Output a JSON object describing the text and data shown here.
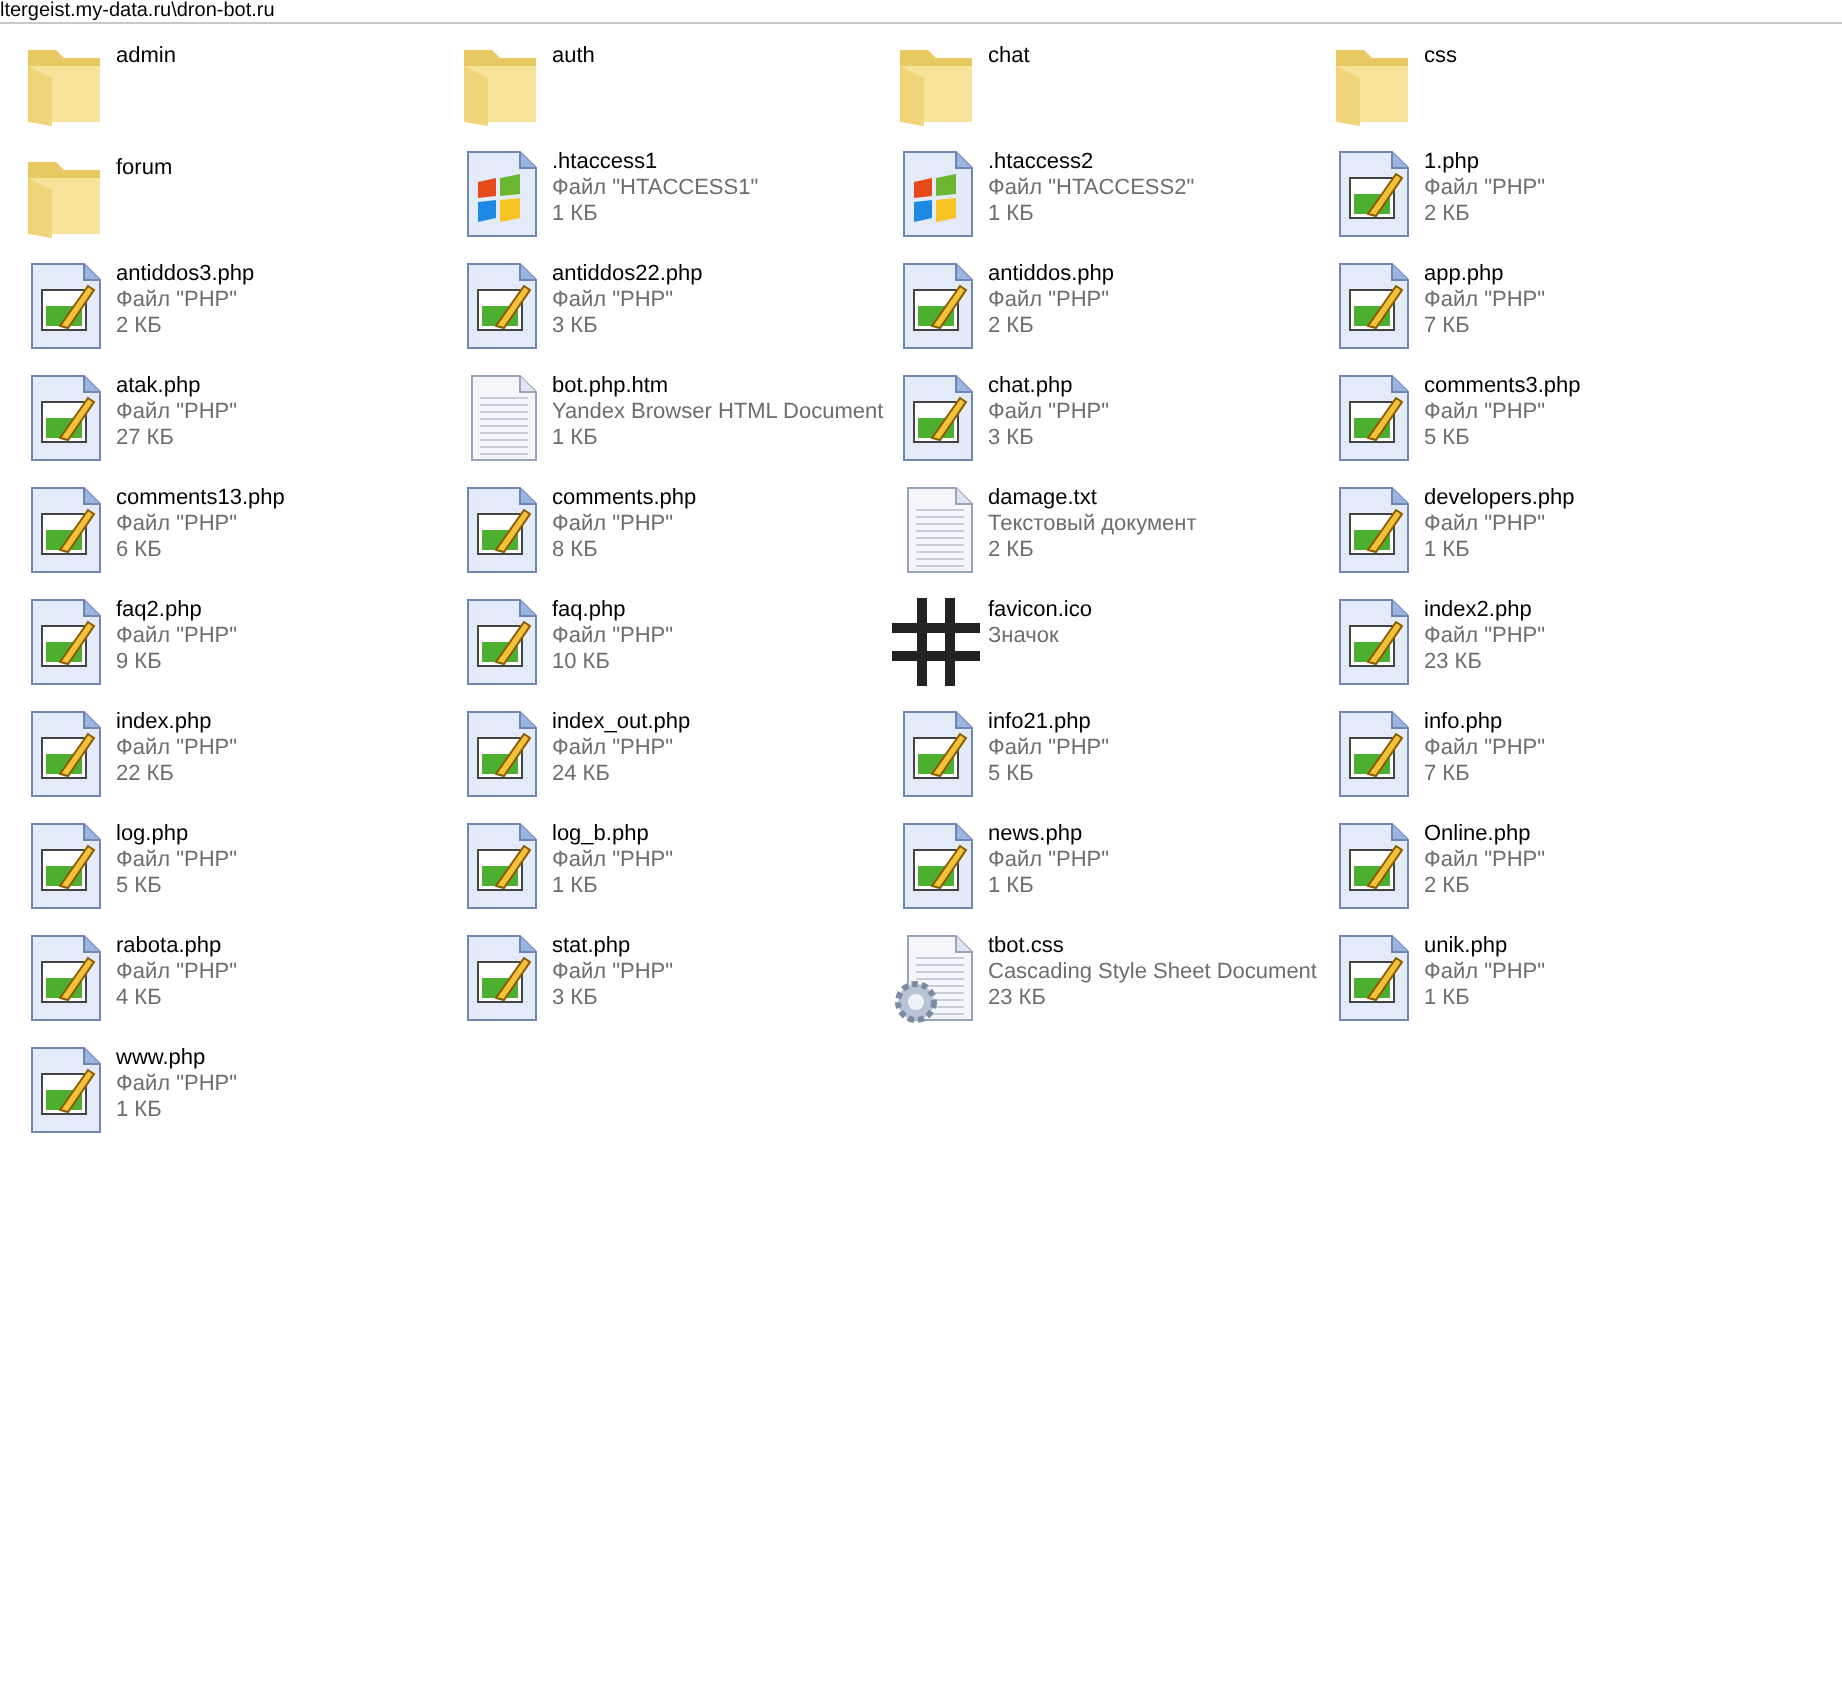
{
  "address_bar": {
    "path": "ltergeist.my-data.ru\\dron-bot.ru"
  },
  "items": [
    {
      "kind": "folder",
      "name": "admin"
    },
    {
      "kind": "folder",
      "name": "auth"
    },
    {
      "kind": "folder",
      "name": "chat"
    },
    {
      "kind": "folder",
      "name": "css"
    },
    {
      "kind": "folder",
      "name": "forum"
    },
    {
      "kind": "windows",
      "name": ".htaccess1",
      "type": "Файл \"HTACCESS1\"",
      "size": "1 КБ"
    },
    {
      "kind": "windows",
      "name": ".htaccess2",
      "type": "Файл \"HTACCESS2\"",
      "size": "1 КБ"
    },
    {
      "kind": "php",
      "name": "1.php",
      "type": "Файл \"PHP\"",
      "size": "2 КБ"
    },
    {
      "kind": "php",
      "name": "antiddos3.php",
      "type": "Файл \"PHP\"",
      "size": "2 КБ"
    },
    {
      "kind": "php",
      "name": "antiddos22.php",
      "type": "Файл \"PHP\"",
      "size": "3 КБ"
    },
    {
      "kind": "php",
      "name": "antiddos.php",
      "type": "Файл \"PHP\"",
      "size": "2 КБ"
    },
    {
      "kind": "php",
      "name": "app.php",
      "type": "Файл \"PHP\"",
      "size": "7 КБ"
    },
    {
      "kind": "php",
      "name": "atak.php",
      "type": "Файл \"PHP\"",
      "size": "27 КБ"
    },
    {
      "kind": "text",
      "name": "bot.php.htm",
      "type": "Yandex Browser HTML Document",
      "size": "1 КБ"
    },
    {
      "kind": "php",
      "name": "chat.php",
      "type": "Файл \"PHP\"",
      "size": "3 КБ"
    },
    {
      "kind": "php",
      "name": "comments3.php",
      "type": "Файл \"PHP\"",
      "size": "5 КБ"
    },
    {
      "kind": "php",
      "name": "comments13.php",
      "type": "Файл \"PHP\"",
      "size": "6 КБ"
    },
    {
      "kind": "php",
      "name": "comments.php",
      "type": "Файл \"PHP\"",
      "size": "8 КБ"
    },
    {
      "kind": "text",
      "name": "damage.txt",
      "type": "Текстовый документ",
      "size": "2 КБ"
    },
    {
      "kind": "php",
      "name": "developers.php",
      "type": "Файл \"PHP\"",
      "size": "1 КБ"
    },
    {
      "kind": "php",
      "name": "faq2.php",
      "type": "Файл \"PHP\"",
      "size": "9 КБ"
    },
    {
      "kind": "php",
      "name": "faq.php",
      "type": "Файл \"PHP\"",
      "size": "10 КБ"
    },
    {
      "kind": "hash",
      "name": "favicon.ico",
      "type": "Значок"
    },
    {
      "kind": "php",
      "name": "index2.php",
      "type": "Файл \"PHP\"",
      "size": "23 КБ"
    },
    {
      "kind": "php",
      "name": "index.php",
      "type": "Файл \"PHP\"",
      "size": "22 КБ"
    },
    {
      "kind": "php",
      "name": "index_out.php",
      "type": "Файл \"PHP\"",
      "size": "24 КБ"
    },
    {
      "kind": "php",
      "name": "info21.php",
      "type": "Файл \"PHP\"",
      "size": "5 КБ"
    },
    {
      "kind": "php",
      "name": "info.php",
      "type": "Файл \"PHP\"",
      "size": "7 КБ"
    },
    {
      "kind": "php",
      "name": "log.php",
      "type": "Файл \"PHP\"",
      "size": "5 КБ"
    },
    {
      "kind": "php",
      "name": "log_b.php",
      "type": "Файл \"PHP\"",
      "size": "1 КБ"
    },
    {
      "kind": "php",
      "name": "news.php",
      "type": "Файл \"PHP\"",
      "size": "1 КБ"
    },
    {
      "kind": "php",
      "name": "Online.php",
      "type": "Файл \"PHP\"",
      "size": "2 КБ"
    },
    {
      "kind": "php",
      "name": "rabota.php",
      "type": "Файл \"PHP\"",
      "size": "4 КБ"
    },
    {
      "kind": "php",
      "name": "stat.php",
      "type": "Файл \"PHP\"",
      "size": "3 КБ"
    },
    {
      "kind": "css",
      "name": "tbot.css",
      "type": "Cascading Style Sheet Document",
      "size": "23 КБ"
    },
    {
      "kind": "php",
      "name": "unik.php",
      "type": "Файл \"PHP\"",
      "size": "1 КБ"
    },
    {
      "kind": "php",
      "name": "www.php",
      "type": "Файл \"PHP\"",
      "size": "1 КБ"
    }
  ]
}
